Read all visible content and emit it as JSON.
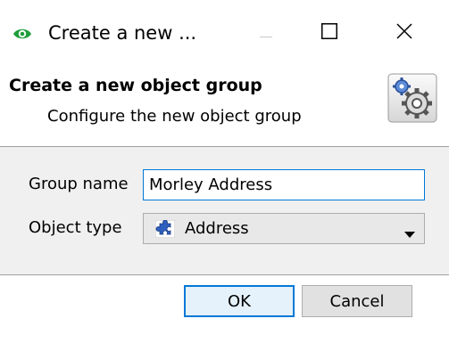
{
  "window": {
    "title": "Create a new ...",
    "icon": "eye-icon",
    "controls": [
      "minimize-icon",
      "maximize-icon",
      "close-icon"
    ]
  },
  "header": {
    "title": "Create a new object group",
    "subtitle": "Configure the new object group",
    "icon": "gear-icon"
  },
  "form": {
    "group_name": {
      "label": "Group name",
      "value": "Morley Address"
    },
    "object_type": {
      "label": "Object type",
      "selected": "Address",
      "icon": "puzzle-icon"
    }
  },
  "buttons": {
    "ok": "OK",
    "cancel": "Cancel"
  },
  "colors": {
    "accent": "#0078d7",
    "panel": "#f0f0f0",
    "eye_green": "#1e9e3a"
  }
}
